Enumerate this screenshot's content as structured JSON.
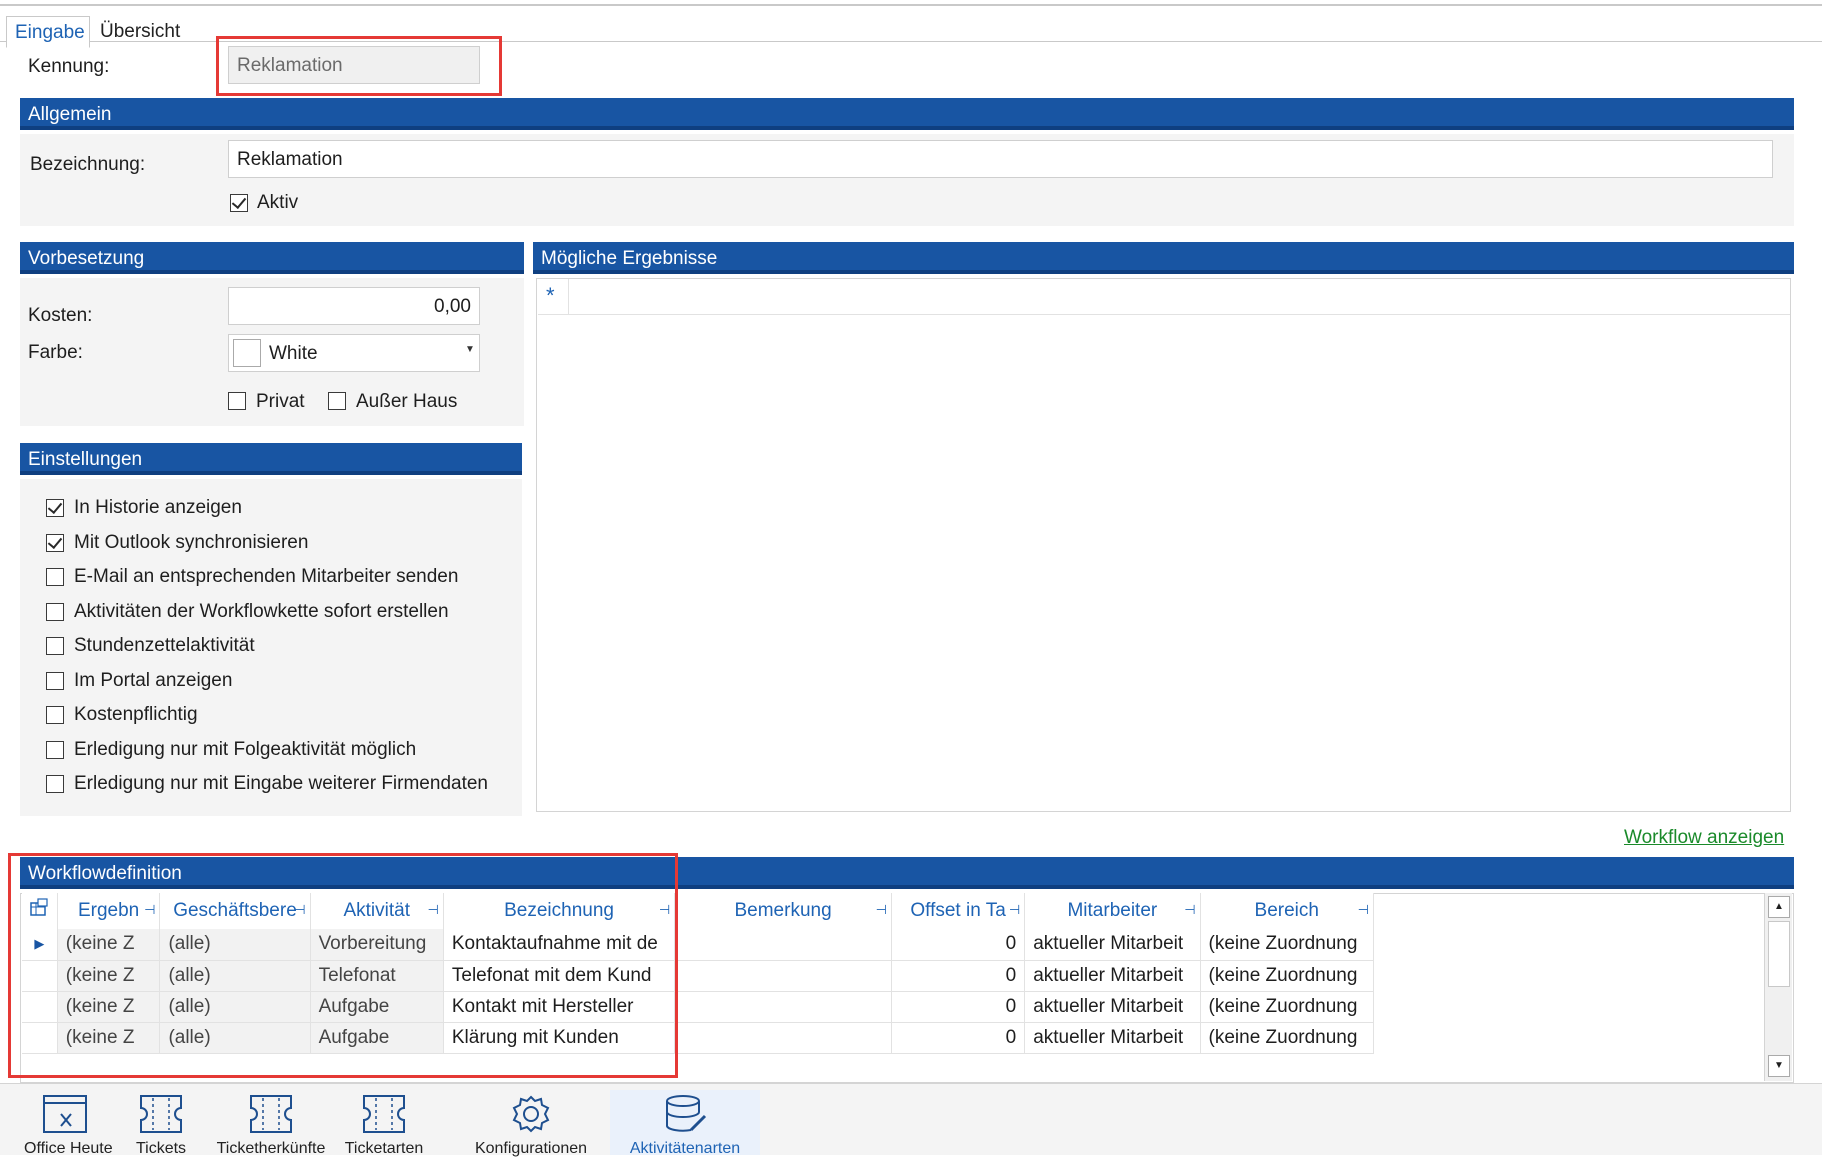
{
  "tabs": [
    {
      "label": "Eingabe",
      "active": true
    },
    {
      "label": "Übersicht",
      "active": false
    }
  ],
  "kennung": {
    "label": "Kennung:",
    "value": "Reklamation"
  },
  "allgemein": {
    "title": "Allgemein",
    "bezeichnung_label": "Bezeichnung:",
    "bezeichnung_value": "Reklamation",
    "aktiv_label": "Aktiv",
    "aktiv_checked": true
  },
  "vorbesetzung": {
    "title": "Vorbesetzung",
    "kosten_label": "Kosten:",
    "kosten_value": "0,00",
    "farbe_label": "Farbe:",
    "farbe_value": "White",
    "privat_label": "Privat",
    "ausser_haus_label": "Außer Haus"
  },
  "ergebnisse": {
    "title": "Mögliche Ergebnisse",
    "new_row_marker": "*"
  },
  "einstellungen": {
    "title": "Einstellungen",
    "items": [
      {
        "label": "In Historie anzeigen",
        "checked": true
      },
      {
        "label": "Mit Outlook synchronisieren",
        "checked": true
      },
      {
        "label": "E-Mail an entsprechenden Mitarbeiter senden",
        "checked": false
      },
      {
        "label": "Aktivitäten der Workflowkette sofort erstellen",
        "checked": false
      },
      {
        "label": "Stundenzettelaktivität",
        "checked": false
      },
      {
        "label": "Im Portal anzeigen",
        "checked": false
      },
      {
        "label": "Kostenpflichtig",
        "checked": false
      },
      {
        "label": "Erledigung nur mit Folgeaktivität möglich",
        "checked": false
      },
      {
        "label": "Erledigung nur mit Eingabe weiterer Firmendaten",
        "checked": false
      }
    ]
  },
  "workflow_link": "Workflow anzeigen",
  "workflow": {
    "title": "Workflowdefinition",
    "columns": [
      "Ergebn",
      "Geschäftsbere",
      "Aktivität",
      "Bezeichnung",
      "Bemerkung",
      "Offset in Ta",
      "Mitarbeiter",
      "Bereich"
    ],
    "rows": [
      [
        "(keine Z",
        "(alle)",
        "Vorbereitung",
        "Kontaktaufnahme mit de",
        "",
        "0",
        "aktueller Mitarbeit",
        "(keine Zuordnung"
      ],
      [
        "(keine Z",
        "(alle)",
        "Telefonat",
        "Telefonat mit dem Kund",
        "",
        "0",
        "aktueller Mitarbeit",
        "(keine Zuordnung"
      ],
      [
        "(keine Z",
        "(alle)",
        "Aufgabe",
        "Kontakt mit Hersteller",
        "",
        "0",
        "aktueller Mitarbeit",
        "(keine Zuordnung"
      ],
      [
        "(keine Z",
        "(alle)",
        "Aufgabe",
        "Klärung mit Kunden",
        "",
        "0",
        "aktueller Mitarbeit",
        "(keine Zuordnung"
      ]
    ]
  },
  "nav": [
    {
      "label": "Office Heute",
      "icon": "calendar-x-icon"
    },
    {
      "label": "Tickets",
      "icon": "ticket-icon"
    },
    {
      "label": "Ticketherkünfte",
      "icon": "ticket-icon"
    },
    {
      "label": "Ticketarten",
      "icon": "ticket-icon"
    },
    {
      "label": "Konfigurationen",
      "icon": "gear-icon"
    },
    {
      "label": "Aktivitätenarten",
      "icon": "database-edit-icon"
    }
  ],
  "colors": {
    "panel_header": "#1855a3",
    "accent_blue": "#1e63b4",
    "highlight_red": "#e53935",
    "link_green": "#1a8a2a"
  }
}
